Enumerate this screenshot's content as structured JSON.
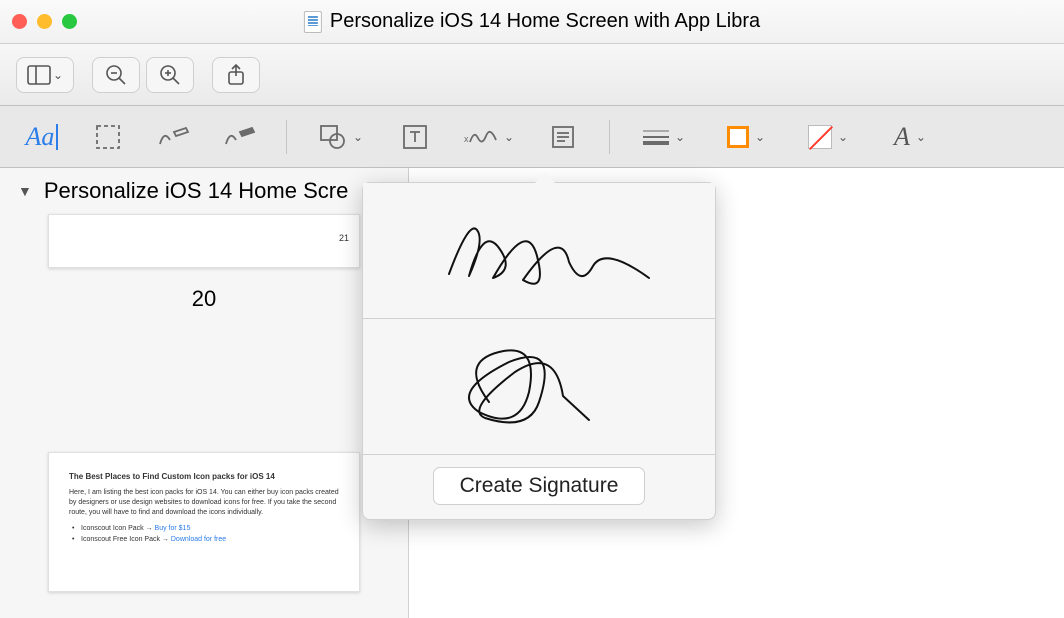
{
  "window": {
    "title": "Personalize iOS 14 Home Screen with App Libra"
  },
  "sidebar": {
    "doc_title": "Personalize iOS 14 Home Scre",
    "thumb1_page": "21",
    "page_label": "20",
    "thumb2": {
      "heading": "The Best Places to Find Custom Icon packs for iOS 14",
      "para": "Here, I am listing the best icon packs for iOS 14. You can either buy icon packs created by designers or use design websites to download icons for free. If you take the second route, you will have to find and download the icons individually.",
      "li1_prefix": "Iconscout Icon Pack → ",
      "li1_link": "Buy for $15",
      "li2_prefix": "Iconscout Free Icon Pack → ",
      "li2_link": "Download for free"
    }
  },
  "popover": {
    "create_label": "Create Signature"
  }
}
